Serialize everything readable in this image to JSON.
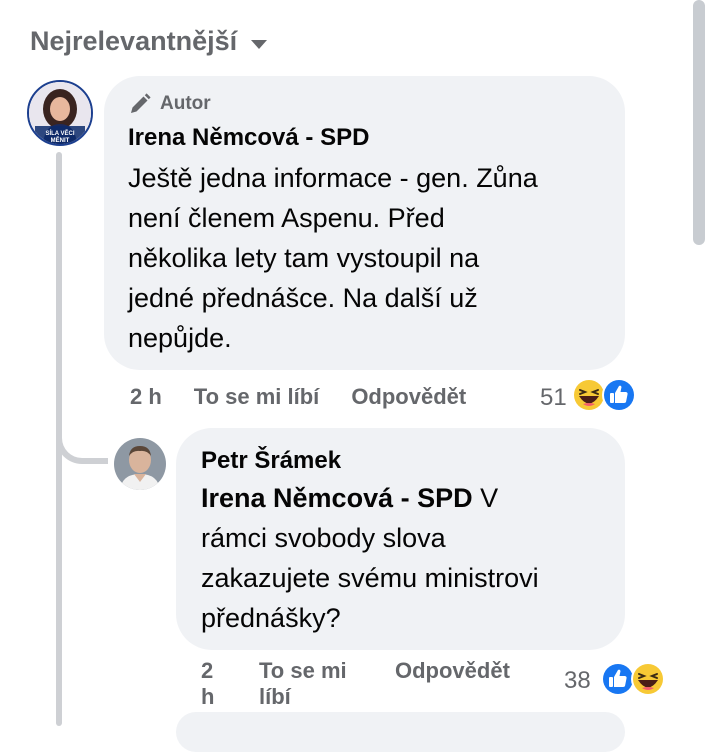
{
  "sort": {
    "label": "Nejrelevantnější"
  },
  "comments": [
    {
      "badge": "Autor",
      "author": "Irena Němcová - SPD",
      "avatar_text": [
        "SÍLA VĚCI",
        "MĚNIT"
      ],
      "text": "Ještě jedna informace - gen. Zůna\nnení členem Aspenu. Před\nněkolika lety tam vystoupil na\njedné přednášce. Na další už\nnepůjde.",
      "time": "2 h",
      "like_label": "To se mi líbí",
      "reply_label": "Odpovědět",
      "reaction_count": "51",
      "reactions": [
        "haha-icon",
        "like-icon"
      ]
    },
    {
      "author": "Petr Šrámek",
      "mention": "Irena Němcová - SPD",
      "text_after_mention": " V",
      "text_rest": "rámci svobody slova\nzakazujete svému ministrovi\npřednášky?",
      "time": "2 h",
      "like_label": "To se mi líbí",
      "reply_label": "Odpovědět",
      "reaction_count": "38",
      "reactions": [
        "like-icon",
        "haha-icon"
      ]
    }
  ],
  "colors": {
    "bubble": "#f0f2f5",
    "secondary_text": "#65676b",
    "like_blue": "#1877f2",
    "haha_yellow": "#f7c935"
  }
}
